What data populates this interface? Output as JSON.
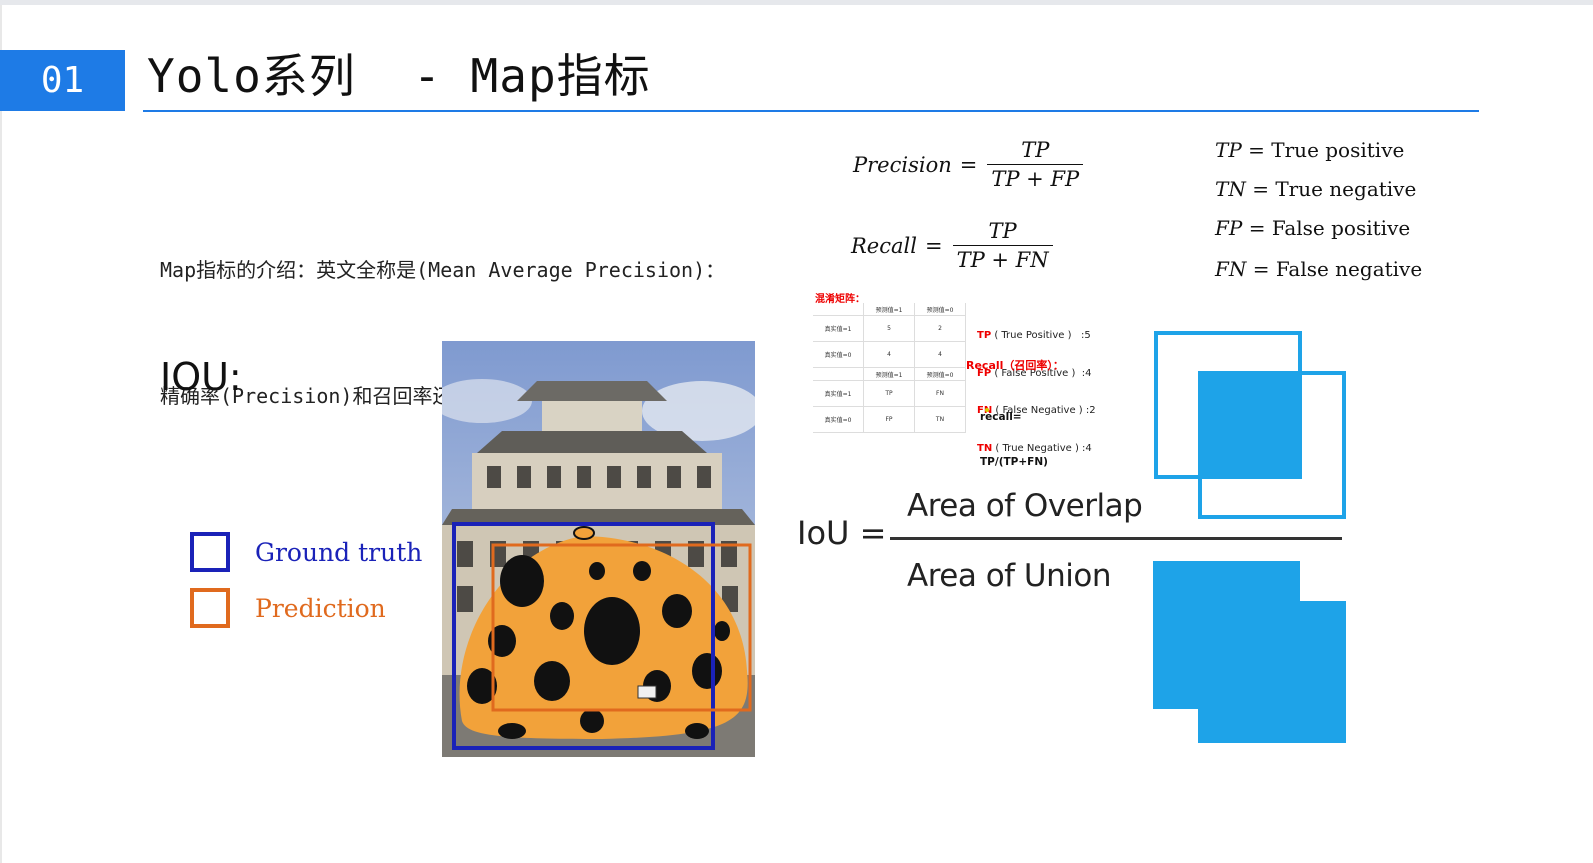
{
  "slide": {
    "number": "01",
    "title": "Yolo系列  - Map指标",
    "accent": "#1e7be6"
  },
  "intro": {
    "line1": "Map指标的介绍：英文全称是(Mean Average Precision)：",
    "line2": "精确率(Precision)和召回率还能继续用么？"
  },
  "formulas": {
    "precision": {
      "lhs": "Precision",
      "eq": "=",
      "num": "TP",
      "den": "TP + FP"
    },
    "recall": {
      "lhs": "Recall",
      "eq": "=",
      "num": "TP",
      "den": "TP + FN"
    }
  },
  "definitions": [
    {
      "abbr": "TP",
      "eq": " = ",
      "text": "True positive"
    },
    {
      "abbr": "TN",
      "eq": " = ",
      "text": "True negative"
    },
    {
      "abbr": "FP",
      "eq": " = ",
      "text": "False positive"
    },
    {
      "abbr": "FN",
      "eq": " = ",
      "text": "False negative"
    }
  ],
  "confusion": {
    "title": "混淆矩阵：",
    "header1": [
      "",
      "预测值=1",
      "预测值=0"
    ],
    "row1": [
      "真实值=1",
      "5",
      "2"
    ],
    "row2": [
      "真实值=0",
      "4",
      "4"
    ],
    "header2": [
      "",
      "预测值=1",
      "预测值=0"
    ],
    "row3": [
      "真实值=1",
      "TP",
      "FN"
    ],
    "row4": [
      "真实值=0",
      "FP",
      "TN"
    ],
    "stats": [
      {
        "abbr": "TP",
        "text": " ( True Positive )   :5"
      },
      {
        "abbr": "FP",
        "text": " ( False Positive )  :4"
      },
      {
        "abbr": "FN",
        "text": " ( False Negative ) :2"
      },
      {
        "abbr": "TN",
        "text": " ( True Negative ) :4"
      }
    ],
    "recall_label": "Recall（召回率）：",
    "recall_formula_1": "recall=",
    "recall_formula_2": "TP/(TP+FN)"
  },
  "iou": {
    "label": "IOU:",
    "legend": [
      {
        "label": "Ground truth",
        "color": "#1a22b8"
      },
      {
        "label": "Prediction",
        "color": "#e06a1e"
      }
    ],
    "equation_lhs": "IoU =",
    "numerator": "Area of Overlap",
    "denominator": "Area of Union",
    "fill_color": "#1ea3e8"
  }
}
